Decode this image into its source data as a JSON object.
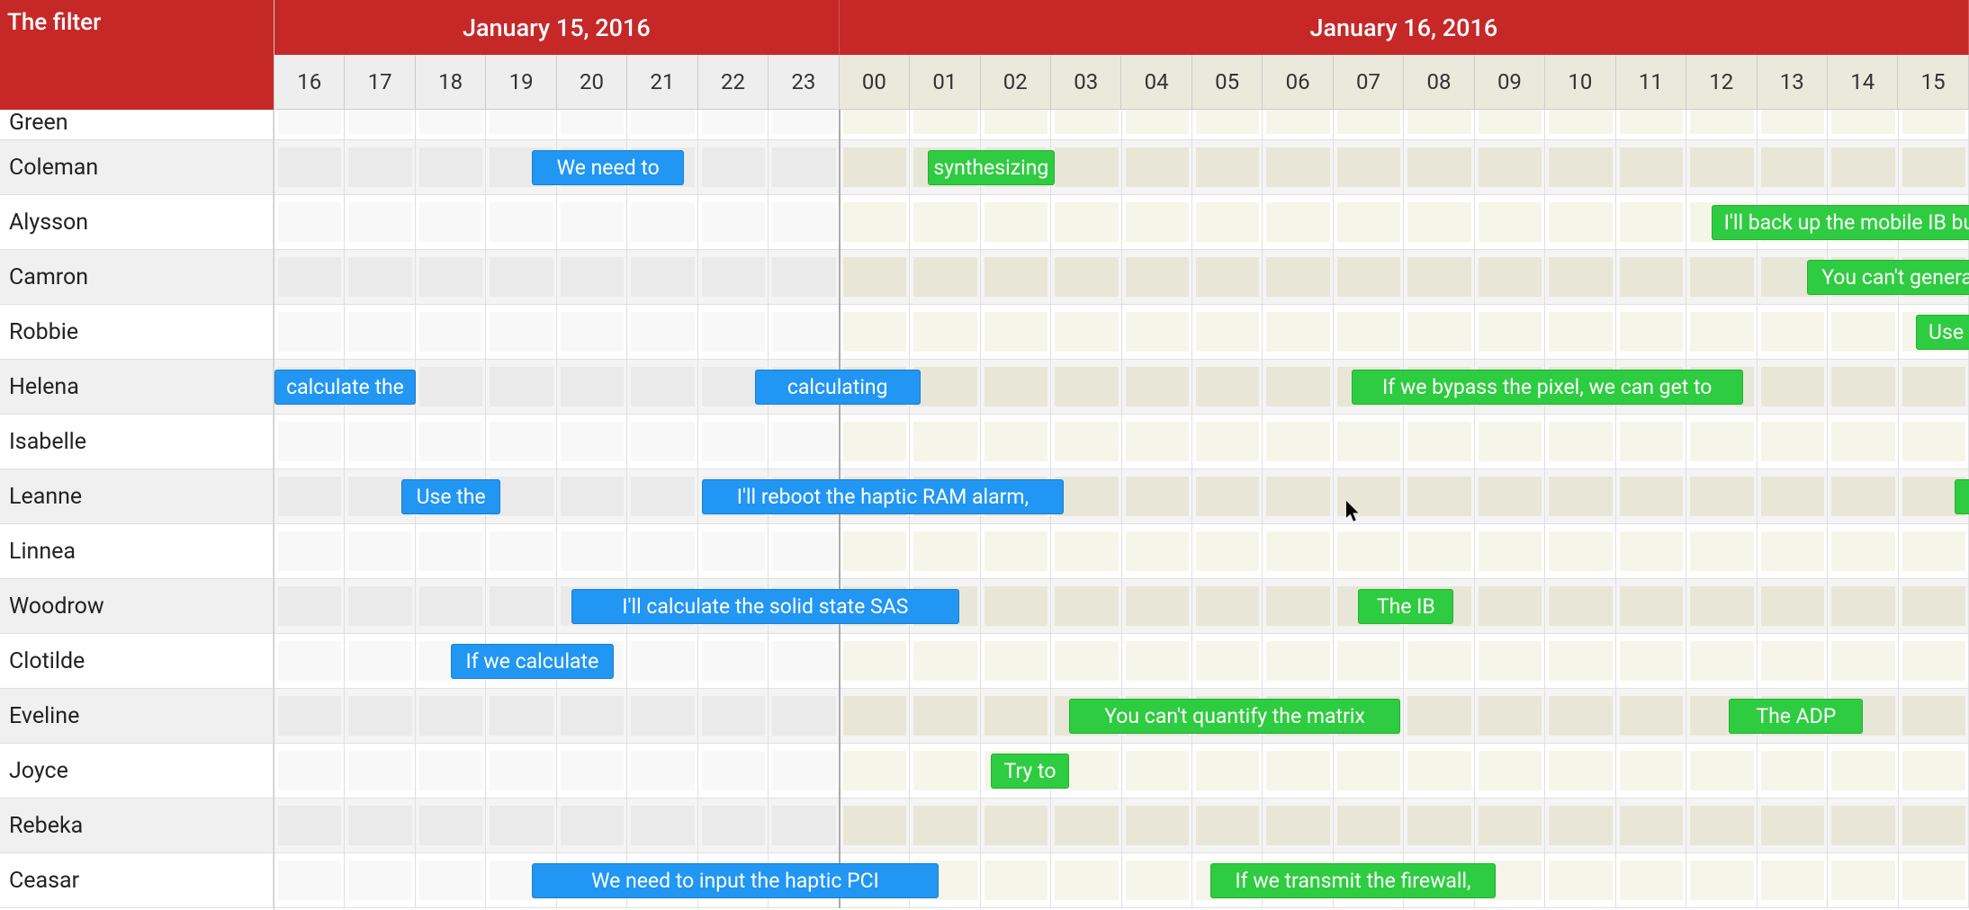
{
  "filter_label": "The filter",
  "dates": [
    {
      "label": "January 15, 2016",
      "hours": 8
    },
    {
      "label": "January 16, 2016",
      "hours": 16
    }
  ],
  "hours": [
    "16",
    "17",
    "18",
    "19",
    "20",
    "21",
    "22",
    "23",
    "00",
    "01",
    "02",
    "03",
    "04",
    "05",
    "06",
    "07",
    "08",
    "09",
    "10",
    "11",
    "12",
    "13",
    "14",
    "15"
  ],
  "hour_width": 78.46,
  "day1_hours": 8,
  "resources": [
    {
      "name": "Green",
      "first": true,
      "events": []
    },
    {
      "name": "Coleman",
      "events": [
        {
          "label": "We need to",
          "color": "blue",
          "start": 3.65,
          "span": 2.15
        },
        {
          "label": "synthesizing",
          "color": "green",
          "start": 9.25,
          "span": 1.8
        }
      ]
    },
    {
      "name": "Alysson",
      "events": [
        {
          "label": "I'll back up the mobile IB bus, that",
          "color": "green",
          "start": 20.35,
          "span": 4.7
        }
      ]
    },
    {
      "name": "Camron",
      "events": [
        {
          "label": "You can't generate the",
          "color": "green",
          "start": 21.7,
          "span": 3.3
        }
      ]
    },
    {
      "name": "Robbie",
      "events": [
        {
          "label": "Use",
          "color": "green",
          "start": 23.25,
          "span": 0.85
        }
      ]
    },
    {
      "name": "Helena",
      "events": [
        {
          "label": "calculate the",
          "color": "blue",
          "start": 0.0,
          "span": 2.0
        },
        {
          "label": "calculating",
          "color": "blue",
          "start": 6.8,
          "span": 2.35
        },
        {
          "label": "If we bypass the pixel, we can get to",
          "color": "green",
          "start": 15.25,
          "span": 5.55
        }
      ]
    },
    {
      "name": "Isabelle",
      "events": []
    },
    {
      "name": "Leanne",
      "events": [
        {
          "label": "Use the",
          "color": "blue",
          "start": 1.8,
          "span": 1.4
        },
        {
          "label": "I'll reboot the haptic RAM alarm,",
          "color": "blue",
          "start": 6.05,
          "span": 5.13
        },
        {
          "label": "",
          "color": "green",
          "start": 23.8,
          "span": 0.3
        }
      ]
    },
    {
      "name": "Linnea",
      "events": []
    },
    {
      "name": "Woodrow",
      "events": [
        {
          "label": "I'll calculate the solid state SAS",
          "color": "blue",
          "start": 4.2,
          "span": 5.5
        },
        {
          "label": "The IB",
          "color": "green",
          "start": 15.35,
          "span": 1.35
        }
      ]
    },
    {
      "name": "Clotilde",
      "events": [
        {
          "label": "If we calculate",
          "color": "blue",
          "start": 2.5,
          "span": 2.3
        }
      ]
    },
    {
      "name": "Eveline",
      "events": [
        {
          "label": "You can't quantify the matrix",
          "color": "green",
          "start": 11.25,
          "span": 4.7
        },
        {
          "label": "The ADP",
          "color": "green",
          "start": 20.6,
          "span": 1.9
        }
      ]
    },
    {
      "name": "Joyce",
      "events": [
        {
          "label": "Try to",
          "color": "green",
          "start": 10.15,
          "span": 1.1
        }
      ]
    },
    {
      "name": "Rebeka",
      "events": []
    },
    {
      "name": "Ceasar",
      "events": [
        {
          "label": "We need to input the haptic PCI",
          "color": "blue",
          "start": 3.65,
          "span": 5.75
        },
        {
          "label": "If we transmit the firewall,",
          "color": "green",
          "start": 13.25,
          "span": 4.05
        }
      ]
    }
  ]
}
